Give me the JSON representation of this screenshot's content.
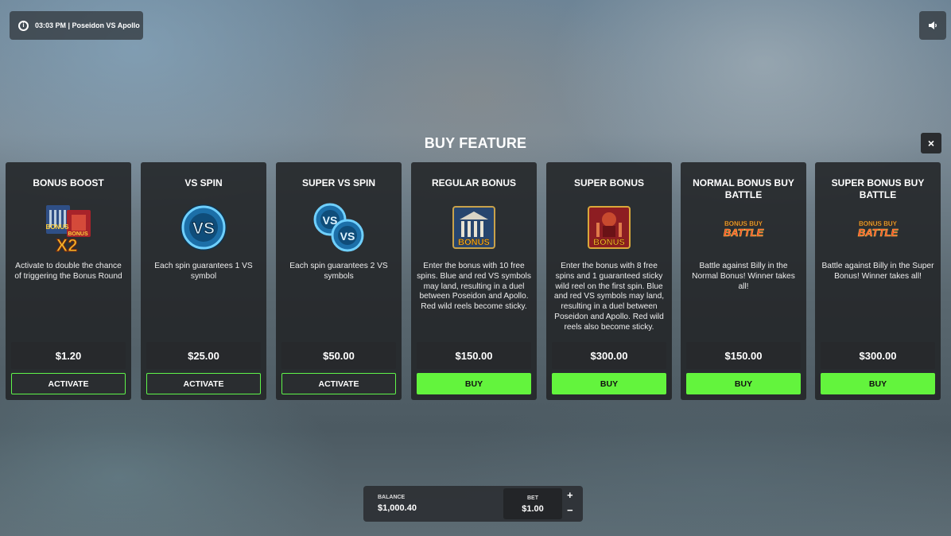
{
  "top_info": {
    "text": "03:03 PM | Poseidon VS Apollo"
  },
  "title": "BUY FEATURE",
  "close_label": "×",
  "cards": [
    {
      "title": "BONUS BOOST",
      "icon": "bonus-x2-icon",
      "image_text": [
        "BONUS",
        "BONUS",
        "X2"
      ],
      "description": "Activate to double the chance of triggering the Bonus Round",
      "price": "$1.20",
      "action": "ACTIVATE"
    },
    {
      "title": "VS SPIN",
      "icon": "vs-symbol-icon",
      "image_text": [
        "VS"
      ],
      "description": "Each spin guarantees 1 VS symbol",
      "price": "$25.00",
      "action": "ACTIVATE"
    },
    {
      "title": "SUPER VS SPIN",
      "icon": "double-vs-symbol-icon",
      "image_text": [
        "VS",
        "VS"
      ],
      "description": "Each spin guarantees 2 VS symbols",
      "price": "$50.00",
      "action": "ACTIVATE"
    },
    {
      "title": "REGULAR BONUS",
      "icon": "temple-bonus-icon",
      "image_text": [
        "BONUS"
      ],
      "description": "Enter the bonus with 10 free spins. Blue and red VS symbols may land, resulting in a duel between Poseidon and Apollo. Red wild reels become sticky.",
      "price": "$150.00",
      "action": "BUY"
    },
    {
      "title": "SUPER BONUS",
      "icon": "red-temple-bonus-icon",
      "image_text": [
        "BONUS"
      ],
      "description": "Enter the bonus with 8 free spins and 1 guaranteed sticky wild reel on the first spin. Blue and red VS symbols may land, resulting in a duel between Poseidon and Apollo. Red wild reels also become sticky.",
      "price": "$300.00",
      "action": "BUY"
    },
    {
      "title": "NORMAL BONUS BUY BATTLE",
      "icon": "bonus-buy-battle-logo",
      "image_text": [
        "BONUS BUY",
        "BATTLE"
      ],
      "description": "Battle against Billy in the Normal Bonus! Winner takes all!",
      "price": "$150.00",
      "action": "BUY"
    },
    {
      "title": "SUPER BONUS BUY BATTLE",
      "icon": "bonus-buy-battle-logo",
      "image_text": [
        "BONUS BUY",
        "BATTLE"
      ],
      "description": "Battle against Billy in the Super Bonus! Winner takes all!",
      "price": "$300.00",
      "action": "BUY"
    }
  ],
  "balance": {
    "label": "BALANCE",
    "value": "$1,000.40"
  },
  "bet": {
    "label": "BET",
    "value": "$1.00",
    "plus": "+",
    "minus": "−"
  },
  "colors": {
    "buy_green": "#63f43d",
    "card_bg": "#222427"
  }
}
